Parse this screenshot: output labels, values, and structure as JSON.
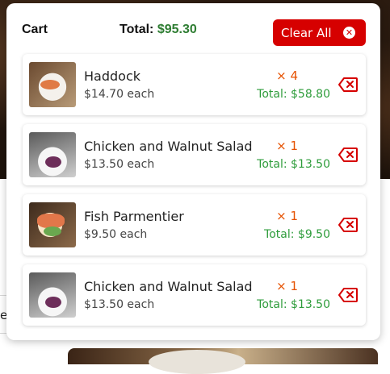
{
  "cart": {
    "title": "Cart",
    "total_label": "Total:",
    "total_amount": "$95.30",
    "clear_label": "Clear All"
  },
  "items": [
    {
      "name": "Haddock",
      "price": "$14.70 each",
      "qty": "× 4",
      "total": "Total: $58.80",
      "thumb": "fish-dish-image"
    },
    {
      "name": "Chicken and Walnut Salad",
      "price": "$13.50 each",
      "qty": "× 1",
      "total": "Total: $13.50",
      "thumb": "salad-dish-image"
    },
    {
      "name": "Fish Parmentier",
      "price": "$9.50 each",
      "qty": "× 1",
      "total": "Total: $9.50",
      "thumb": "salmon-dish-image"
    },
    {
      "name": "Chicken and Walnut Salad",
      "price": "$13.50 each",
      "qty": "× 1",
      "total": "Total: $13.50",
      "thumb": "salad-dish-image"
    }
  ],
  "background": {
    "left_edge_text": "e"
  },
  "colors": {
    "accent_red": "#d60000",
    "total_green": "#2e7d32",
    "qty_orange": "#e65100",
    "item_total_green": "#2e9c3b"
  }
}
